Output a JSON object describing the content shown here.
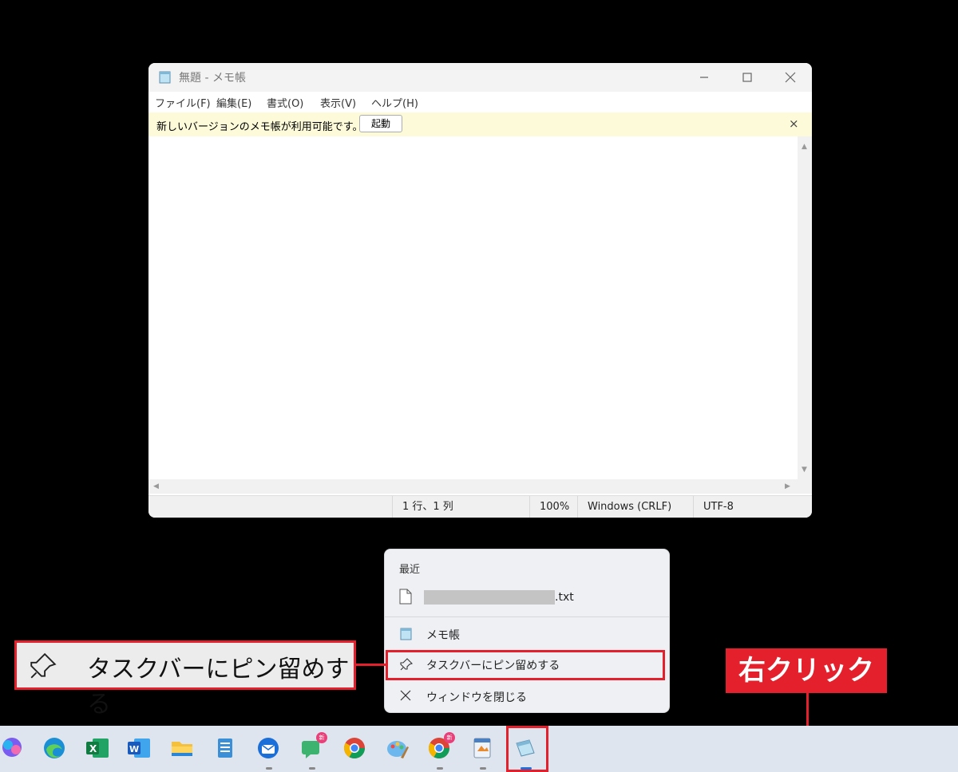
{
  "notepad": {
    "title": "無題 - メモ帳",
    "menu": [
      "ファイル(F)",
      "編集(E)",
      "書式(O)",
      "表示(V)",
      "ヘルプ(H)"
    ],
    "notice": {
      "message": "新しいバージョンのメモ帳が利用可能です。",
      "button": "起動",
      "close": "×"
    },
    "status": {
      "position": "1 行、1 列",
      "zoom": "100%",
      "line_ending": "Windows (CRLF)",
      "encoding": "UTF-8"
    }
  },
  "jump_list": {
    "recent_header": "最近",
    "recent_file_ext": ".txt",
    "app_name": "メモ帳",
    "pin": "タスクバーにピン留めする",
    "close": "ウィンドウを閉じる"
  },
  "annotations": {
    "pin_callout": "タスクバーにピン留めする",
    "right_click": "右クリック"
  },
  "taskbar": {
    "icons": [
      "copilot-icon",
      "edge-icon",
      "excel-icon",
      "word-icon",
      "file-explorer-icon",
      "notepad-plus-icon",
      "thunderbird-icon",
      "chat-icon",
      "chrome-icon",
      "paint-icon",
      "chrome-profile-icon",
      "wordpad-icon",
      "notepad-icon"
    ],
    "badge_text": "新"
  },
  "colors": {
    "accent_red": "#e3202b",
    "notice_bg": "#fcfad9",
    "taskbar_bg": "#dfe5ee"
  }
}
